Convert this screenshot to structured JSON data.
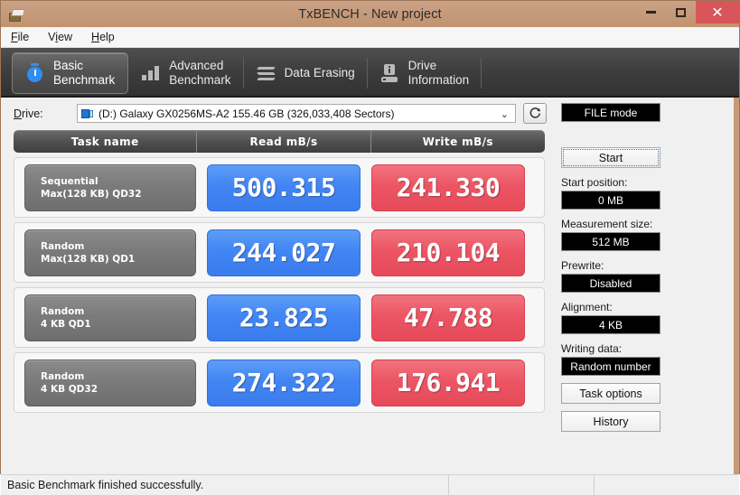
{
  "window": {
    "title": "TxBENCH - New project",
    "app_icon": "drive-tool-icon",
    "controls": {
      "minimize": "minimize-icon",
      "maximize": "maximize-icon",
      "close": "✕"
    }
  },
  "menubar": {
    "items": [
      {
        "label": "File",
        "accel": "F"
      },
      {
        "label": "View",
        "accel": "V"
      },
      {
        "label": "Help",
        "accel": "H"
      }
    ]
  },
  "tabs": [
    {
      "label": "Basic\nBenchmark",
      "icon": "stopwatch-icon",
      "active": true
    },
    {
      "label": "Advanced\nBenchmark",
      "icon": "bar-chart-icon",
      "active": false
    },
    {
      "label": "Data Erasing",
      "icon": "zigzag-erase-icon",
      "active": false
    },
    {
      "label": "Drive\nInformation",
      "icon": "drive-info-icon",
      "active": false
    }
  ],
  "drive": {
    "label": "Drive:",
    "selected": "(D:) Galaxy GX0256MS-A2  155.46 GB (326,033,408 Sectors)",
    "dropdown_arrow": "⌄",
    "refresh_icon": "refresh-icon"
  },
  "results": {
    "headers": [
      "Task name",
      "Read mB/s",
      "Write mB/s"
    ],
    "rows": [
      {
        "task_line1": "Sequential",
        "task_line2": "Max(128 KB) QD32",
        "read": "500.315",
        "write": "241.330"
      },
      {
        "task_line1": "Random",
        "task_line2": "Max(128 KB) QD1",
        "read": "244.027",
        "write": "210.104"
      },
      {
        "task_line1": "Random",
        "task_line2": "4 KB QD1",
        "read": "23.825",
        "write": "47.788"
      },
      {
        "task_line1": "Random",
        "task_line2": "4 KB QD32",
        "read": "274.322",
        "write": "176.941"
      }
    ]
  },
  "side": {
    "file_mode": "FILE mode",
    "start_button": "Start",
    "start_position_label": "Start position:",
    "start_position_value": "0 MB",
    "measurement_size_label": "Measurement size:",
    "measurement_size_value": "512 MB",
    "prewrite_label": "Prewrite:",
    "prewrite_value": "Disabled",
    "alignment_label": "Alignment:",
    "alignment_value": "4 KB",
    "writing_data_label": "Writing data:",
    "writing_data_value": "Random number",
    "task_options_button": "Task options",
    "history_button": "History"
  },
  "statusbar": {
    "message": "Basic Benchmark finished successfully."
  },
  "colors": {
    "read_blue": "#4285f4",
    "write_red": "#ec5564",
    "frame_brown": "#c49a78",
    "close_red": "#d9555a",
    "tab_dark": "#3d3d3d"
  }
}
